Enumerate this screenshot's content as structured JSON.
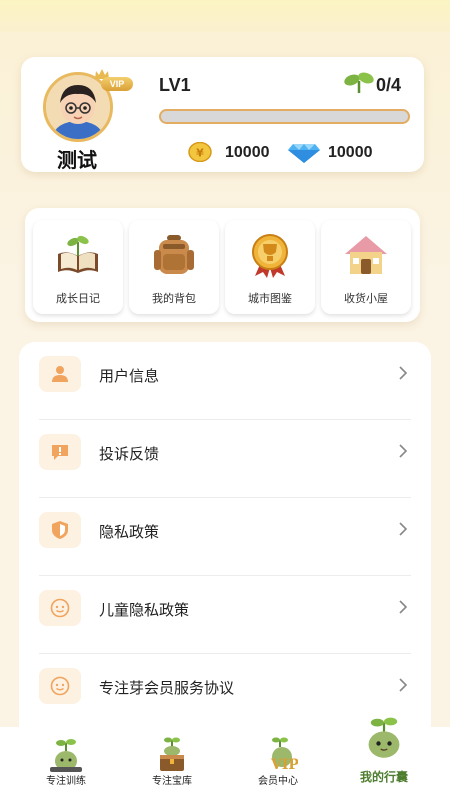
{
  "profile": {
    "username": "测试",
    "vip_badge": "VIP",
    "level": "LV1",
    "progress": "0/4",
    "progress_fraction": 0,
    "coins": "10000",
    "diamonds": "10000"
  },
  "quick_access": [
    {
      "label": "成长日记",
      "icon": "growth-diary-icon"
    },
    {
      "label": "我的背包",
      "icon": "backpack-icon"
    },
    {
      "label": "城市图鉴",
      "icon": "trophy-medal-icon"
    },
    {
      "label": "收货小屋",
      "icon": "cabin-icon"
    }
  ],
  "menu": [
    {
      "label": "用户信息",
      "icon": "user-icon"
    },
    {
      "label": "投诉反馈",
      "icon": "feedback-icon"
    },
    {
      "label": "隐私政策",
      "icon": "shield-icon"
    },
    {
      "label": "儿童隐私政策",
      "icon": "child-face-icon"
    },
    {
      "label": "专注芽会员服务协议",
      "icon": "child-face-icon"
    }
  ],
  "bottom_nav": [
    {
      "label": "专注训练",
      "active": false
    },
    {
      "label": "专注宝库",
      "active": false
    },
    {
      "label": "会员中心",
      "active": false
    },
    {
      "label": "我的行囊",
      "active": true
    }
  ],
  "colors": {
    "background": "#fbf3e3",
    "accent_gold": "#e2ad62",
    "icon_tint": "#f0a45e",
    "active_nav": "#4d7d2e"
  }
}
